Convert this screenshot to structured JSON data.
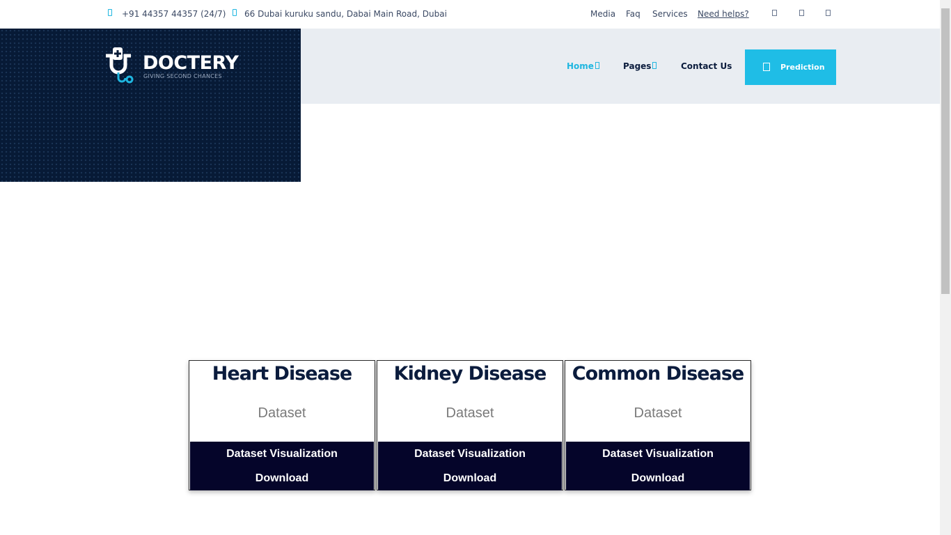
{
  "topbar": {
    "phone": "+91 44357 44357 (24/7)",
    "address": "66 Dubai kuruku sandu, Dabai Main Road, Dubai",
    "links": [
      "Media",
      "Faq",
      "Services",
      "Need helps?"
    ]
  },
  "brand": {
    "name": "DOCTERY",
    "tagline": "GIVING SECOND CHANCES"
  },
  "nav": {
    "items": [
      "Home",
      "Pages",
      "Contact Us"
    ],
    "prediction_label": "Prediction"
  },
  "cards": [
    {
      "title": "Heart Disease",
      "subtitle": "Dataset",
      "visualization_label": "Dataset Visualization",
      "download_label": "Download"
    },
    {
      "title": "Kidney Disease",
      "subtitle": "Dataset",
      "visualization_label": "Dataset Visualization",
      "download_label": "Download"
    },
    {
      "title": "Common Disease",
      "subtitle": "Dataset",
      "visualization_label": "Dataset Visualization",
      "download_label": "Download"
    }
  ],
  "colors": {
    "accent": "#1fbde6",
    "navy": "#071a36",
    "card_footer": "#05052a"
  }
}
